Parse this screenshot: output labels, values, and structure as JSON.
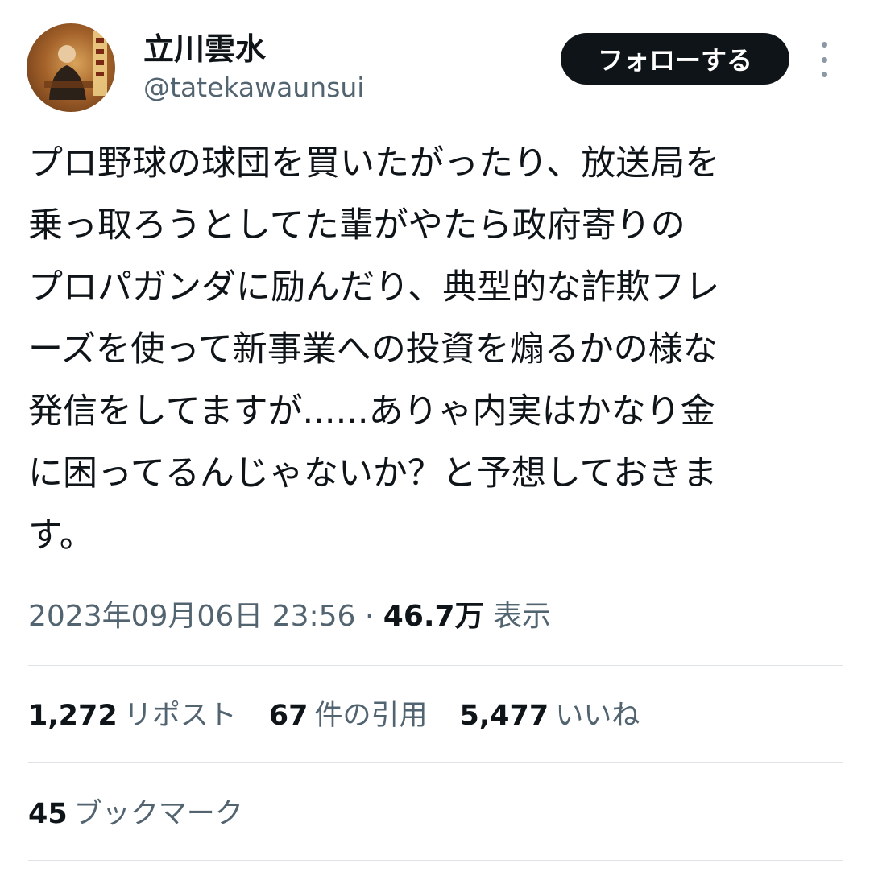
{
  "author": {
    "display_name": "立川雲水",
    "handle": "@tatekawaunsui"
  },
  "follow_button_label": "フォローする",
  "tweet": {
    "lines": [
      "プロ野球の球団を買いたがったり、放送局を",
      "乗っ取ろうとしてた輩がやたら政府寄りの",
      "プロパガンダに励んだり、典型的な詐欺フレ",
      "ーズを使って新事業への投資を煽るかの様な",
      "発信をしてますが......ありゃ内実はかなり金",
      "に困ってるんじゃないか？と予想しておきま",
      "す。"
    ]
  },
  "meta": {
    "timestamp": "2023年09月06日 23:56",
    "separator": " · ",
    "views_count": "46.7万",
    "views_label": "表示"
  },
  "stats": {
    "reposts": {
      "count": "1,272",
      "label": "リポスト"
    },
    "quotes": {
      "count": "67",
      "label": "件の引用"
    },
    "likes": {
      "count": "5,477",
      "label": "いいね"
    },
    "bookmarks": {
      "count": "45",
      "label": "ブックマーク"
    }
  },
  "icons": {
    "more": "more-vertical-icon",
    "avatar": "profile-avatar"
  },
  "colors": {
    "text_primary": "#0f1419",
    "text_secondary": "#536471",
    "follow_button_bg": "#0f1419",
    "divider": "#dfe3e6"
  }
}
